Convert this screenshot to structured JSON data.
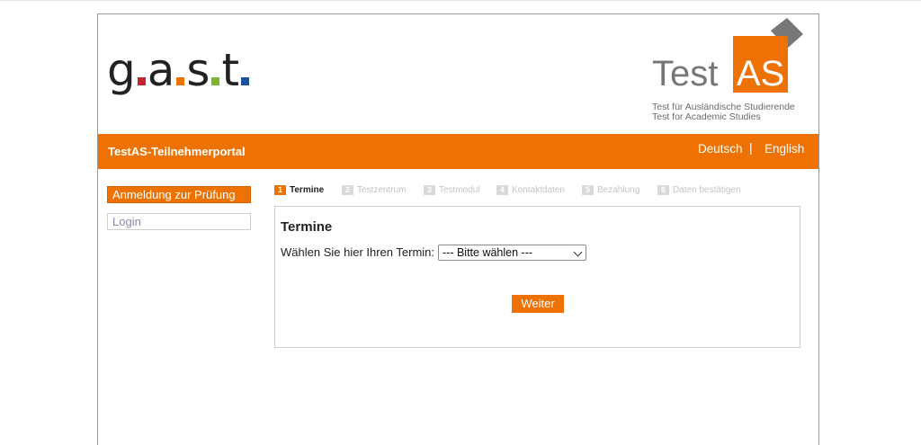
{
  "header": {
    "gast_logo": {
      "letters": [
        "g",
        "a",
        "s",
        "t"
      ],
      "dot_colors": [
        "#c1272d",
        "#ee7203",
        "#78b928",
        "#1d4f9c"
      ]
    },
    "testas_logo": {
      "word_left": "Test",
      "word_box": "AS",
      "tagline_1": "Test für Ausländische Studierende",
      "tagline_2": "Test for Academic Studies",
      "accent_color": "#ee7203"
    }
  },
  "navbar": {
    "title": "TestAS-Teilnehmerportal",
    "lang_de": "Deutsch",
    "separator": "|",
    "lang_en": "English",
    "color": "#ee7203"
  },
  "sidebar": {
    "items": [
      {
        "label": "Anmeldung zur Prüfung",
        "active": true
      },
      {
        "label": "Login",
        "active": false
      }
    ]
  },
  "steps": [
    {
      "num": "1",
      "label": "Termine",
      "active": true
    },
    {
      "num": "2",
      "label": "Testzentrum",
      "active": false
    },
    {
      "num": "3",
      "label": "Testmodul",
      "active": false
    },
    {
      "num": "4",
      "label": "Kontaktdaten",
      "active": false
    },
    {
      "num": "5",
      "label": "Bezahlung",
      "active": false
    },
    {
      "num": "6",
      "label": "Daten bestätigen",
      "active": false
    }
  ],
  "panel": {
    "title": "Termine",
    "field_label": "Wählen Sie hier Ihren Termin:",
    "select_value": "--- Bitte wählen ---",
    "next_button": "Weiter"
  }
}
